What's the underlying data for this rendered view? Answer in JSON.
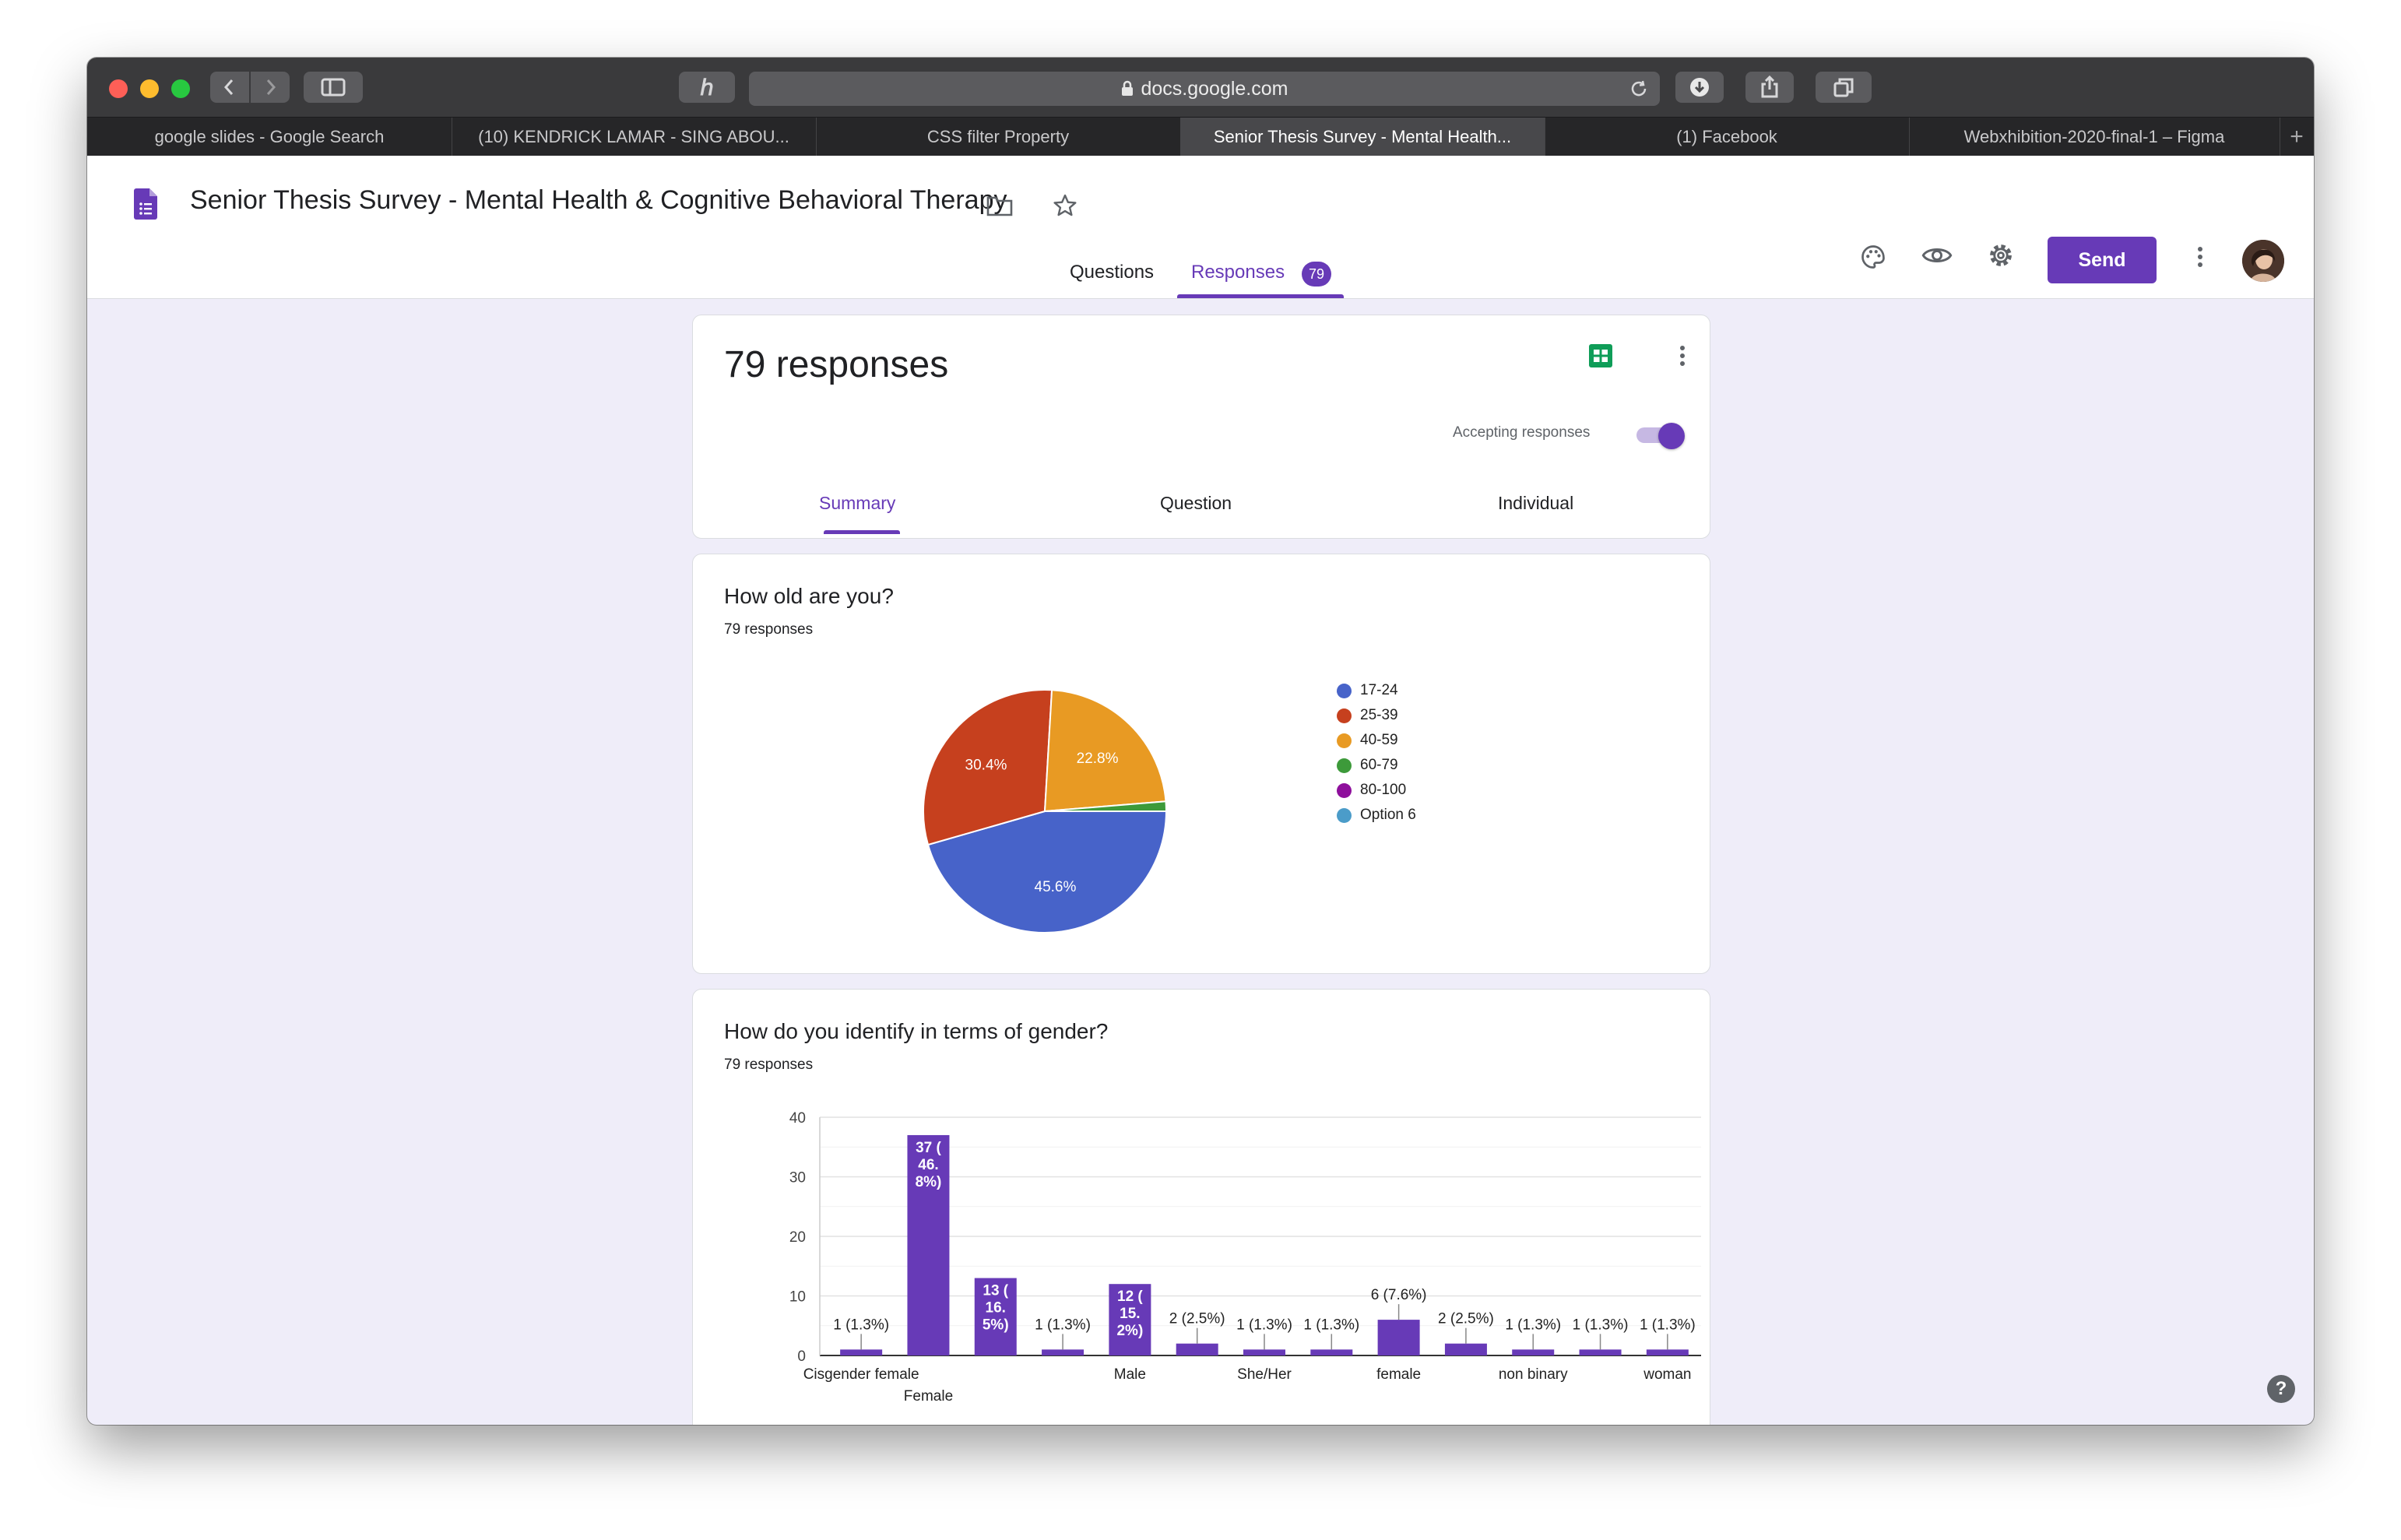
{
  "browser": {
    "url": "docs.google.com",
    "tabs": [
      {
        "label": "google slides - Google Search",
        "active": false
      },
      {
        "label": "(10) KENDRICK LAMAR - SING ABOU...",
        "active": false
      },
      {
        "label": "CSS filter Property",
        "active": false
      },
      {
        "label": "Senior Thesis Survey - Mental Health...",
        "active": true
      },
      {
        "label": "(1) Facebook",
        "active": false
      },
      {
        "label": "Webxhibition-2020-final-1 – Figma",
        "active": false
      }
    ]
  },
  "header": {
    "title": "Senior Thesis Survey - Mental Health & Cognitive Behavioral Therapy",
    "send_label": "Send",
    "tabs": {
      "questions": "Questions",
      "responses": "Responses",
      "responses_badge": "79"
    },
    "accent": "#673ab7"
  },
  "summary": {
    "heading": "79 responses",
    "accepting_label": "Accepting responses",
    "accepting": true,
    "tabs": {
      "summary": "Summary",
      "question": "Question",
      "individual": "Individual"
    }
  },
  "questions": [
    {
      "title": "How old are you?",
      "count_label": "79 responses"
    },
    {
      "title": "How do you identify in terms of gender?",
      "count_label": "79 responses"
    }
  ],
  "chart_data": [
    {
      "type": "pie",
      "title": "How old are you?",
      "slices": [
        {
          "label": "17-24",
          "value": 45.6,
          "color": "#4763c9",
          "display": "45.6%"
        },
        {
          "label": "25-39",
          "value": 30.4,
          "color": "#c6401e",
          "display": "30.4%"
        },
        {
          "label": "40-59",
          "value": 22.8,
          "color": "#e89a23",
          "display": "22.8%"
        },
        {
          "label": "60-79",
          "value": 1.3,
          "color": "#3d9a3a",
          "display": ""
        },
        {
          "label": "80-100",
          "value": 0,
          "color": "#8e0f9c",
          "display": ""
        },
        {
          "label": "Option 6",
          "value": 0,
          "color": "#4b9cc9",
          "display": ""
        }
      ]
    },
    {
      "type": "bar",
      "title": "How do you identify in terms of gender?",
      "color": "#673ab7",
      "ylim": [
        0,
        40
      ],
      "yticks": [
        0,
        10,
        20,
        30,
        40
      ],
      "bars": [
        {
          "label": "Cisgender female",
          "value": 1,
          "display": "1 (1.3%)"
        },
        {
          "label": "Female",
          "value": 37,
          "display": "37 (46.8%)"
        },
        {
          "label": "",
          "value": 13,
          "display": "13 (16.5%)"
        },
        {
          "label": "",
          "value": 1,
          "display": "1 (1.3%)"
        },
        {
          "label": "Male",
          "value": 12,
          "display": "12 (15.2%)"
        },
        {
          "label": "",
          "value": 2,
          "display": "2 (2.5%)"
        },
        {
          "label": "She/Her",
          "value": 1,
          "display": "1 (1.3%)"
        },
        {
          "label": "",
          "value": 1,
          "display": "1 (1.3%)"
        },
        {
          "label": "female",
          "value": 6,
          "display": "6 (7.6%)"
        },
        {
          "label": "",
          "value": 2,
          "display": "2 (2.5%)"
        },
        {
          "label": "non binary",
          "value": 1,
          "display": "1 (1.3%)"
        },
        {
          "label": "",
          "value": 1,
          "display": "1 (1.3%)"
        },
        {
          "label": "woman",
          "value": 1,
          "display": "1 (1.3%)"
        }
      ],
      "xtick_labels": [
        "Cisgender female",
        "Female",
        "Male",
        "She/Her",
        "female",
        "non binary",
        "woman"
      ]
    }
  ]
}
